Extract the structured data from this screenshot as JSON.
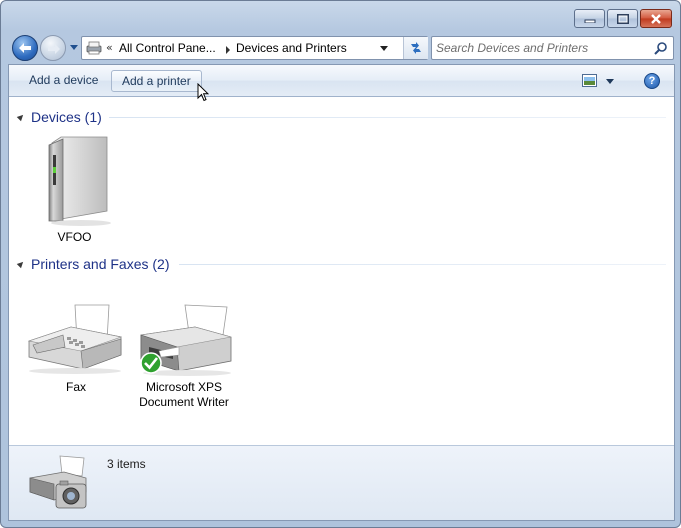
{
  "window": {
    "minimize_icon": "minimize-icon",
    "maximize_icon": "maximize-icon",
    "close_icon": "close-icon"
  },
  "nav": {
    "back_icon": "back-arrow-icon",
    "forward_icon": "forward-arrow-icon",
    "breadcrumb_overflow": "«",
    "breadcrumb": [
      "All Control Pane...",
      "Devices and Printers"
    ],
    "refresh_icon": "refresh-icon",
    "search_placeholder": "Search Devices and Printers"
  },
  "commandbar": {
    "add_device": "Add a device",
    "add_printer": "Add a printer",
    "view_icon": "change-view-icon",
    "help_label": "?"
  },
  "sections": [
    {
      "title": "Devices (1)",
      "items": [
        {
          "label": "VFOO",
          "icon": "computer-tower-icon"
        }
      ]
    },
    {
      "title": "Printers and Faxes (2)",
      "items": [
        {
          "label": "Fax",
          "icon": "fax-machine-icon"
        },
        {
          "label_line1": "Microsoft XPS",
          "label_line2": "Document Writer",
          "icon": "printer-icon",
          "default_badge": "default-check-icon"
        }
      ]
    }
  ],
  "status": {
    "count": "3 items",
    "icon": "devices-and-printers-icon"
  },
  "colors": {
    "section_title": "#1e3287",
    "accent": "#2f6cc0",
    "default_check": "#2fa12f"
  }
}
